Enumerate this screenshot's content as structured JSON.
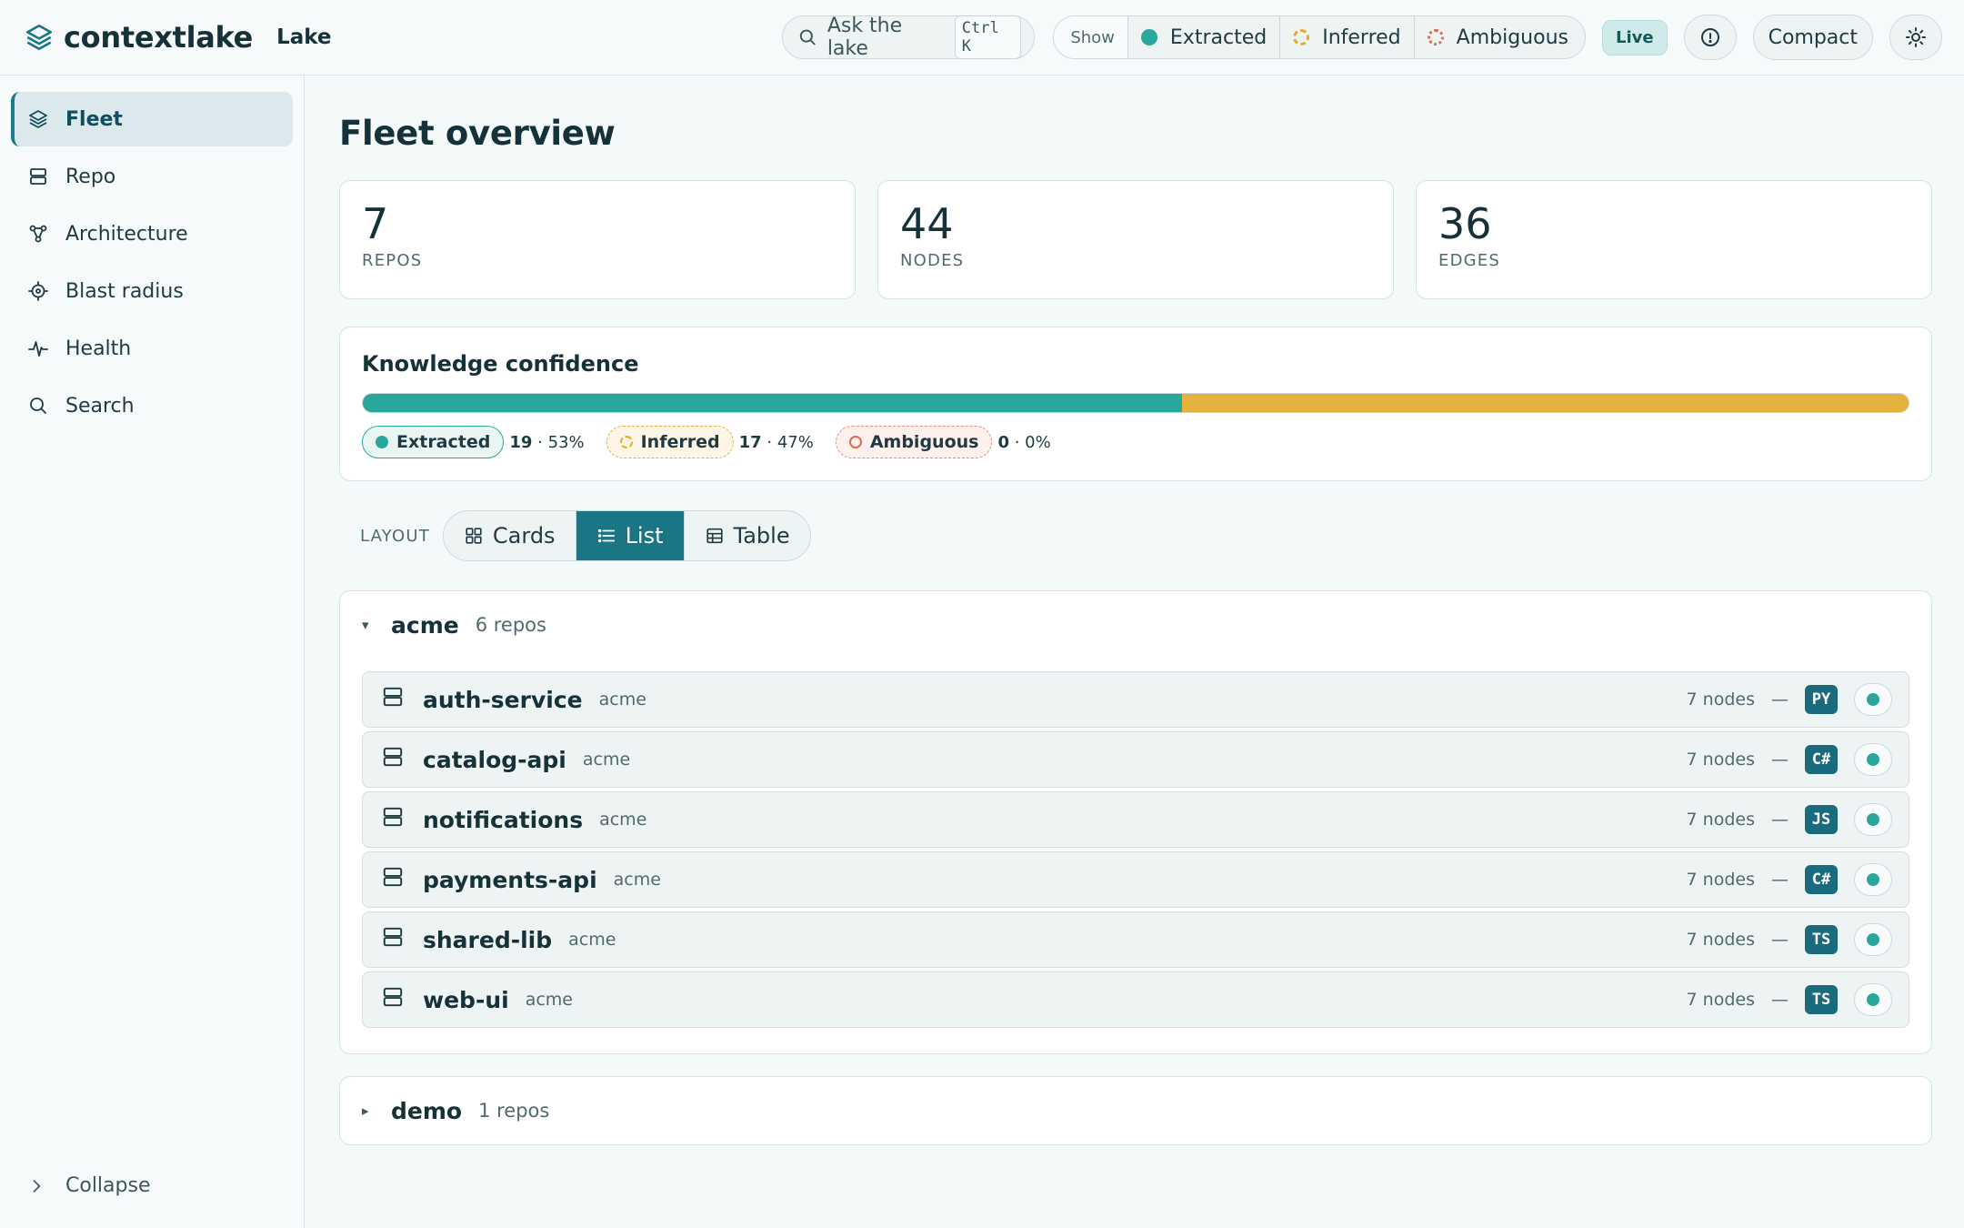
{
  "header": {
    "brand": "contextlake",
    "section": "Lake",
    "search_label": "Ask the lake",
    "search_shortcut": "Ctrl K",
    "show_label": "Show",
    "filters": [
      {
        "label": "Extracted",
        "style": "solid",
        "color": "#2aa79c"
      },
      {
        "label": "Inferred",
        "style": "dashed",
        "color": "#e3ab33"
      },
      {
        "label": "Ambiguous",
        "style": "dotted",
        "color": "#e06a4f"
      }
    ],
    "live_badge": "Live",
    "info_icon": "info-icon",
    "compact_label": "Compact",
    "theme_icon": "sun-icon"
  },
  "sidebar": {
    "items": [
      {
        "label": "Fleet",
        "icon": "layers-icon",
        "active": true
      },
      {
        "label": "Repo",
        "icon": "server-icon",
        "active": false
      },
      {
        "label": "Architecture",
        "icon": "graph-icon",
        "active": false
      },
      {
        "label": "Blast radius",
        "icon": "target-icon",
        "active": false
      },
      {
        "label": "Health",
        "icon": "pulse-icon",
        "active": false
      },
      {
        "label": "Search",
        "icon": "search-icon",
        "active": false
      }
    ],
    "collapse_label": "Collapse"
  },
  "main": {
    "title": "Fleet overview",
    "stats": [
      {
        "value": "7",
        "label": "REPOS"
      },
      {
        "value": "44",
        "label": "NODES"
      },
      {
        "value": "36",
        "label": "EDGES"
      }
    ],
    "confidence": {
      "title": "Knowledge confidence",
      "extracted": {
        "label": "Extracted",
        "count": "19",
        "pct": "53%",
        "fraction": 0.53
      },
      "inferred": {
        "label": "Inferred",
        "count": "17",
        "pct": "47%",
        "fraction": 0.47
      },
      "ambiguous": {
        "label": "Ambiguous",
        "count": "0",
        "pct": "0%",
        "fraction": 0.0
      }
    },
    "layout": {
      "label": "LAYOUT",
      "options": [
        {
          "label": "Cards",
          "icon": "grid-icon",
          "active": false
        },
        {
          "label": "List",
          "icon": "list-icon",
          "active": true
        },
        {
          "label": "Table",
          "icon": "table-icon",
          "active": false
        }
      ]
    },
    "groups": [
      {
        "name": "acme",
        "count": "6 repos",
        "expanded": true,
        "repos": [
          {
            "name": "auth-service",
            "org": "acme",
            "nodes": "7 nodes",
            "dash": "—",
            "lang": "PY"
          },
          {
            "name": "catalog-api",
            "org": "acme",
            "nodes": "7 nodes",
            "dash": "—",
            "lang": "C#"
          },
          {
            "name": "notifications",
            "org": "acme",
            "nodes": "7 nodes",
            "dash": "—",
            "lang": "JS"
          },
          {
            "name": "payments-api",
            "org": "acme",
            "nodes": "7 nodes",
            "dash": "—",
            "lang": "C#"
          },
          {
            "name": "shared-lib",
            "org": "acme",
            "nodes": "7 nodes",
            "dash": "—",
            "lang": "TS"
          },
          {
            "name": "web-ui",
            "org": "acme",
            "nodes": "7 nodes",
            "dash": "—",
            "lang": "TS"
          }
        ]
      },
      {
        "name": "demo",
        "count": "1 repos",
        "expanded": false
      }
    ],
    "carets": {
      "expanded": "▾",
      "collapsed": "▸"
    }
  },
  "colors": {
    "accent": "#1a7585",
    "extracted": "#2aa79c",
    "inferred": "#e6b23d",
    "ambiguous": "#e06a4f"
  }
}
